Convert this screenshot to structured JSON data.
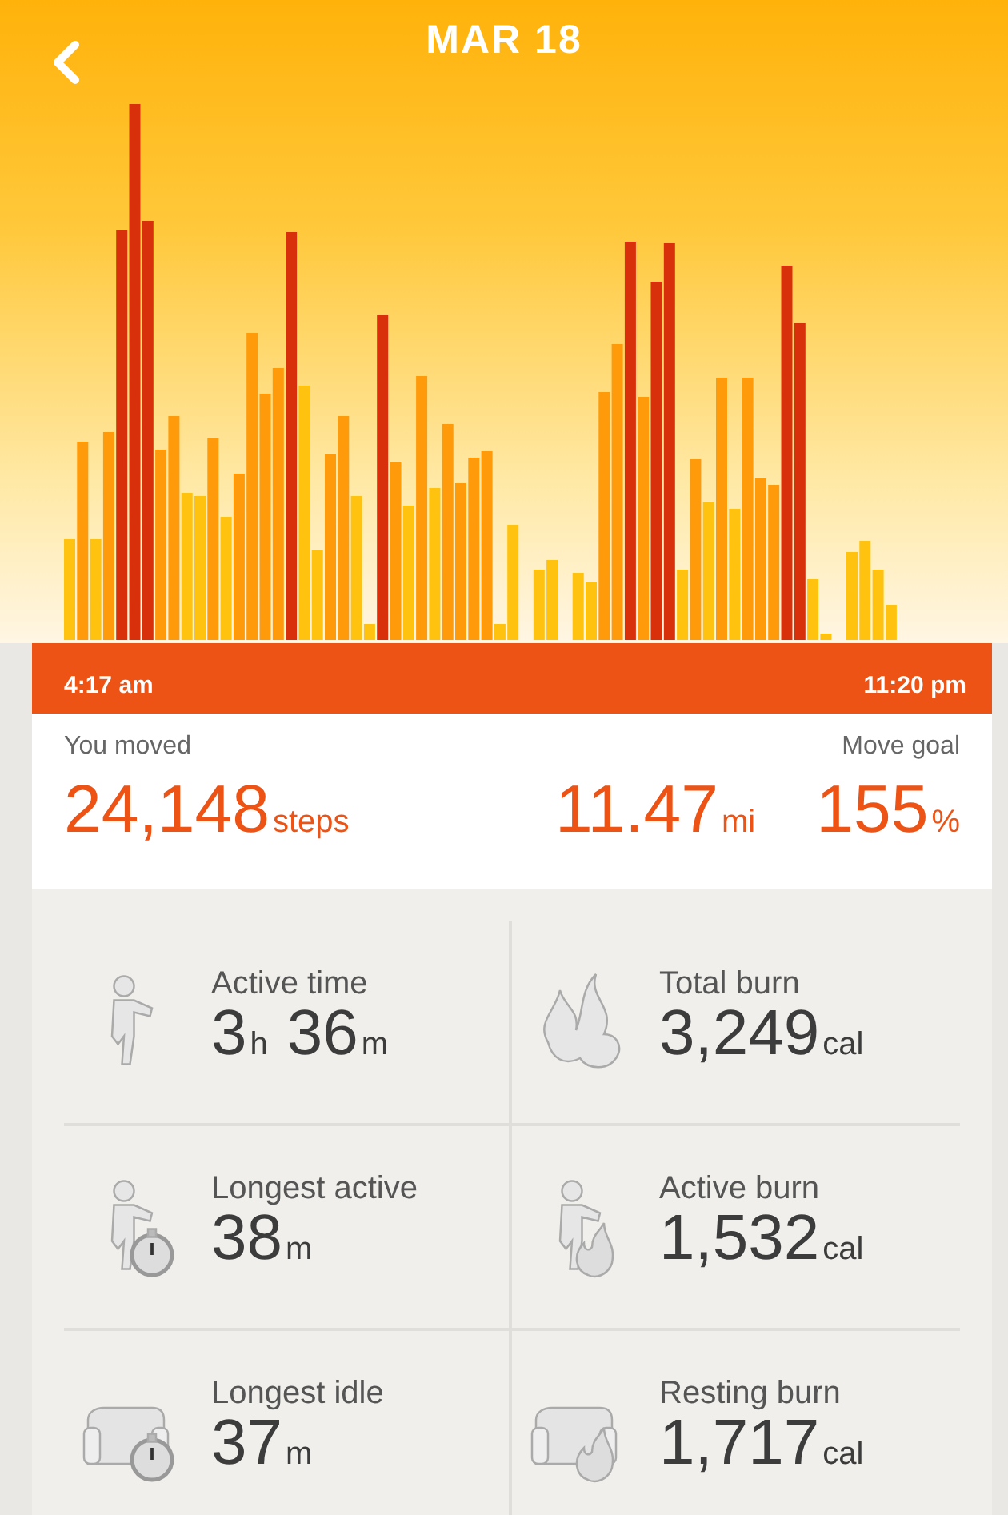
{
  "header": {
    "title": "MAR 18"
  },
  "timeline": {
    "start": "4:17 am",
    "end": "11:20 pm"
  },
  "summary": {
    "moved_label": "You moved",
    "goal_label": "Move goal",
    "values": [
      {
        "num": "24,148",
        "unit": "steps"
      },
      {
        "num": "11.47",
        "unit": "mi"
      },
      {
        "num": "155",
        "unit": "%"
      }
    ]
  },
  "stats": [
    {
      "kind": "runner",
      "label": "Active time",
      "value": [
        {
          "num": "3",
          "unit": "h"
        },
        {
          "num": "36",
          "unit": "m"
        }
      ]
    },
    {
      "kind": "flames",
      "label": "Total burn",
      "value": [
        {
          "num": "3,249",
          "unit": "cal"
        }
      ]
    },
    {
      "kind": "runner-stopwatch",
      "label": "Longest active",
      "value": [
        {
          "num": "38",
          "unit": "m"
        }
      ]
    },
    {
      "kind": "runner-flame",
      "label": "Active burn",
      "value": [
        {
          "num": "1,532",
          "unit": "cal"
        }
      ]
    },
    {
      "kind": "chair-stopwatch",
      "label": "Longest idle",
      "value": [
        {
          "num": "37",
          "unit": "m"
        }
      ]
    },
    {
      "kind": "chair-flame",
      "label": "Resting burn",
      "value": [
        {
          "num": "1,717",
          "unit": "cal"
        }
      ]
    }
  ]
}
